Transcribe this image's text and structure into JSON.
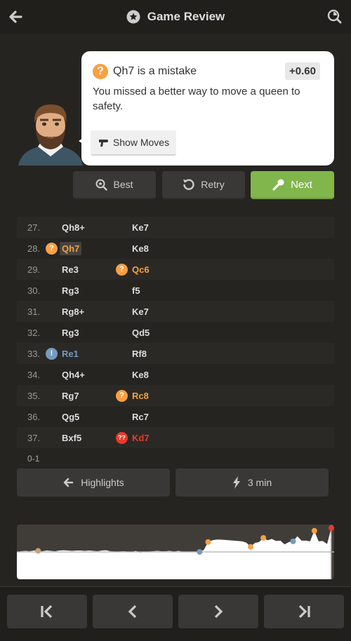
{
  "header": {
    "title": "Game Review",
    "back_icon": "arrow-left-icon",
    "title_icon": "star-circle-icon",
    "analysis_icon": "magnifier-icon"
  },
  "coach": {
    "headline": "Qh7 is a mistake",
    "evaluation": "+0.60",
    "description": "You missed a better way to move a queen to safety.",
    "show_moves_label": "Show Moves"
  },
  "actions": {
    "best": "Best",
    "retry": "Retry",
    "next": "Next"
  },
  "colors": {
    "mistake": "#f7a044",
    "blunder": "#e93a2a",
    "great": "#749bbf",
    "next_button": "#81b64c",
    "background": "#262421"
  },
  "moves": [
    {
      "num": "27.",
      "white": "Qh8+",
      "black": "Ke7"
    },
    {
      "num": "28.",
      "white": "Qh7",
      "white_tag": "mistake",
      "white_selected": true,
      "black": "Ke8"
    },
    {
      "num": "29.",
      "white": "Re3",
      "black": "Qc6",
      "black_tag": "mistake"
    },
    {
      "num": "30.",
      "white": "Rg3",
      "black": "f5"
    },
    {
      "num": "31.",
      "white": "Rg8+",
      "black": "Ke7"
    },
    {
      "num": "32.",
      "white": "Rg3",
      "black": "Qd5"
    },
    {
      "num": "33.",
      "white": "Re1",
      "white_tag": "great",
      "black": "Rf8"
    },
    {
      "num": "34.",
      "white": "Qh4+",
      "black": "Ke8"
    },
    {
      "num": "35.",
      "white": "Rg7",
      "black": "Rc8",
      "black_tag": "mistake"
    },
    {
      "num": "36.",
      "white": "Qg5",
      "black": "Rc7"
    },
    {
      "num": "37.",
      "white": "Bxf5",
      "black": "Kd7",
      "black_tag": "blunder"
    }
  ],
  "result": "0-1",
  "bottom": {
    "highlights": "Highlights",
    "time_control": "3 min"
  },
  "chart_data": {
    "type": "area",
    "ylim": [
      -8,
      8
    ],
    "evals": [
      0,
      0.2,
      0.3,
      0.2,
      0.4,
      0.3,
      0.2,
      0.4,
      0.3,
      0.2,
      0.4,
      0.5,
      0.4,
      0.3,
      0.4,
      0.4,
      0.3,
      0.4,
      0.3,
      0.2,
      0.4,
      0.5,
      0.2,
      0.1,
      0.1,
      0.2,
      0.1,
      0.0,
      0.3,
      -0.2,
      0.0,
      0.1,
      0.2,
      0.3,
      0.2,
      0.2,
      0.3,
      0.1,
      0.3,
      0.1,
      0.0,
      0.0,
      0.1,
      0.0,
      0.6,
      2.9,
      3.4,
      3.6,
      3.6,
      3.5,
      3.4,
      3.3,
      3.2,
      3.1,
      2.7,
      1.5,
      2.6,
      2.9,
      4.1,
      3.4,
      3.8,
      3.2,
      3.3,
      2.2,
      2.9,
      3.1,
      4.6,
      3.3,
      3.3,
      3.1,
      6.2,
      3.1,
      3.2,
      2.3,
      7.0
    ],
    "markers": [
      {
        "ply": 5,
        "type": "book",
        "color": "#c9a178"
      },
      {
        "ply": 43,
        "type": "great",
        "color": "#749bbf"
      },
      {
        "ply": 45,
        "type": "mistake",
        "color": "#f7a044"
      },
      {
        "ply": 55,
        "type": "mistake",
        "color": "#f7a044"
      },
      {
        "ply": 58,
        "type": "mistake",
        "color": "#f7a044"
      },
      {
        "ply": 65,
        "type": "great",
        "color": "#749bbf"
      },
      {
        "ply": 70,
        "type": "mistake",
        "color": "#f7a044"
      },
      {
        "ply": 74,
        "type": "blunder",
        "color": "#e93a2a"
      }
    ]
  },
  "nav": {
    "first": "skip-back-icon",
    "prev": "chevron-left-icon",
    "next": "chevron-right-icon",
    "last": "skip-forward-icon"
  }
}
